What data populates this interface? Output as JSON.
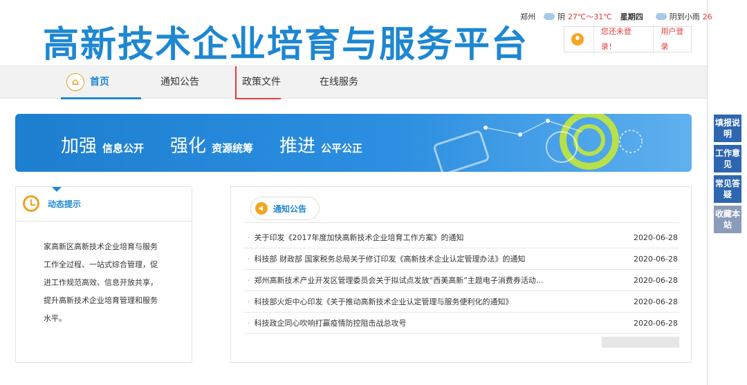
{
  "header": {
    "site_title": "高新技术企业培育与服务平台",
    "city": "郑州",
    "weather_1": "阴",
    "temp_range": "27℃～31℃",
    "weekday": "星期四",
    "weather_2": "阴到小雨",
    "temp_next": "26",
    "login_status": "您还未登录！",
    "login_button": "用户登录"
  },
  "nav": {
    "items": [
      "首页",
      "通知公告",
      "政策文件",
      "在线服务"
    ]
  },
  "side": {
    "buttons": [
      "填报说明",
      "工作意见",
      "常见答疑",
      "收藏本站"
    ]
  },
  "banner": {
    "s1_big": "加强",
    "s1_small": "信息公开",
    "s2_big": "强化",
    "s2_small": "资源统筹",
    "s3_big": "推进",
    "s3_small": "公平公正"
  },
  "dynamic": {
    "title": "动态提示",
    "text": "家高新区高新技术企业培育与服务工作全过程、一站式综合管理，促进工作规范高效、信息开放共享，提升高新技术企业培育管理和服务水平。"
  },
  "notice": {
    "title": "通知公告",
    "items": [
      {
        "text": "关于印发《2017年度加快高新技术企业培育工作方案》的通知",
        "date": "2020-06-28"
      },
      {
        "text": "科技部 财政部 国家税务总局关于修订印发《高新技术企业认定管理办法》的通知",
        "date": "2020-06-28"
      },
      {
        "text": "郑州高新技术产业开发区管理委员会关于拟试点发放“西美高新”主题电子消费券活动...",
        "date": "2020-06-28"
      },
      {
        "text": "科技部火炬中心印发《关于推动高新技术企业认定管理与服务便利化的通知》",
        "date": "2020-06-28"
      },
      {
        "text": "科技政企同心吹响打赢疫情防控阻击战总攻号",
        "date": "2020-06-28"
      }
    ]
  },
  "colors": {
    "brand": "#1e87d2",
    "accent": "#e03a3a",
    "side": "#2f66b0"
  }
}
